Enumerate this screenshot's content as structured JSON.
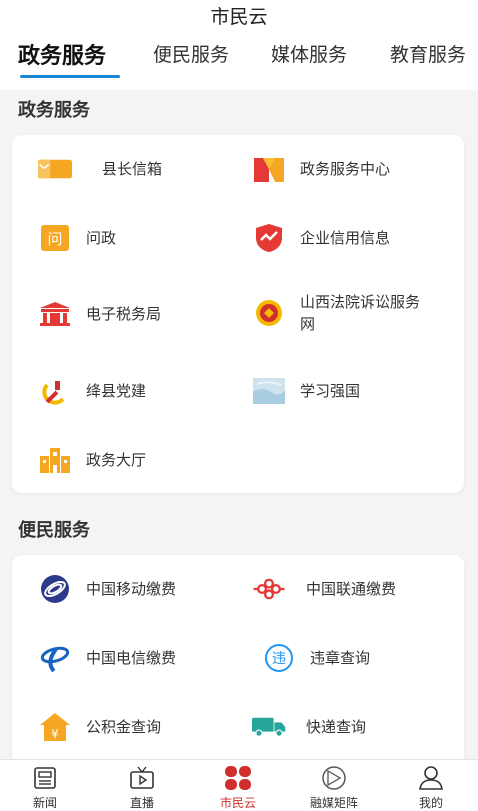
{
  "header": {
    "title": "市民云",
    "tabs": [
      {
        "label": "政务服务",
        "active": true
      },
      {
        "label": "便民服务",
        "active": false
      },
      {
        "label": "媒体服务",
        "active": false
      },
      {
        "label": "教育服务",
        "active": false
      }
    ]
  },
  "government": {
    "title": "政务服务",
    "items": [
      {
        "label": "县长信箱",
        "icon": "mailbox-icon"
      },
      {
        "label": "政务服务中心",
        "icon": "service-center-logo-icon"
      },
      {
        "label": "问政",
        "icon": "question-icon"
      },
      {
        "label": "企业信用信息",
        "icon": "credit-shield-icon"
      },
      {
        "label": "电子税务局",
        "icon": "tax-bureau-icon"
      },
      {
        "label": "山西法院诉讼服务网",
        "icon": "court-emblem-icon"
      },
      {
        "label": "绛县党建",
        "icon": "party-emblem-icon"
      },
      {
        "label": "学习强国",
        "icon": "study-image-icon"
      },
      {
        "label": "政务大厅",
        "icon": "hall-building-icon"
      }
    ]
  },
  "convenience": {
    "title": "便民服务",
    "items": [
      {
        "label": "中国移动缴费",
        "icon": "china-mobile-icon"
      },
      {
        "label": "中国联通缴费",
        "icon": "china-unicom-icon"
      },
      {
        "label": "中国电信缴费",
        "icon": "china-telecom-icon"
      },
      {
        "label": "违章查询",
        "icon": "violation-icon"
      },
      {
        "label": "公积金查询",
        "icon": "housing-fund-icon"
      },
      {
        "label": "快递查询",
        "icon": "delivery-truck-icon"
      }
    ]
  },
  "nav": {
    "items": [
      {
        "label": "新闻",
        "icon": "news-icon"
      },
      {
        "label": "直播",
        "icon": "tv-icon"
      },
      {
        "label": "市民云",
        "icon": "clover-icon",
        "active": true
      },
      {
        "label": "融媒矩阵",
        "icon": "media-matrix-icon"
      },
      {
        "label": "我的",
        "icon": "user-icon"
      }
    ]
  },
  "colors": {
    "accent": "#1a86d8",
    "active_nav": "#d32e2e",
    "orange": "#f5a623",
    "red": "#e53935"
  }
}
